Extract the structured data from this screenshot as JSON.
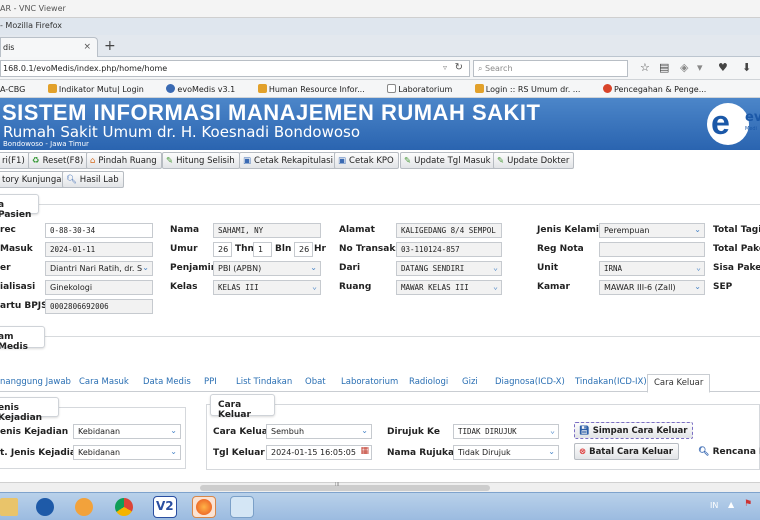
{
  "vnc_title": "AR - VNC Viewer",
  "firefox_title": "- Mozilla Firefox",
  "tab": {
    "label": "dis",
    "close": "×",
    "new": "+"
  },
  "url": "168.0.1/evoMedis/index.php/home/home",
  "search_placeholder": "Search",
  "bookmarks": [
    "A-CBG",
    "Indikator Mutu| Login",
    "evoMedis v3.1",
    "Human Resource Infor...",
    "Laboratorium",
    "Login :: RS Umum dr. ...",
    "Pencegahan & Penge..."
  ],
  "banner": {
    "title": "SISTEM INFORMASI MANAJEMEN RUMAH SAKIT",
    "subtitle": "Rumah Sakit Umum dr. H. Koesnadi Bondowoso",
    "location": "Bondowoso - Jawa Timur",
    "logo_text": "ev",
    "logo_sub": "Medi"
  },
  "toolbar": [
    {
      "label": "ri(F1)",
      "icon": "search-icon"
    },
    {
      "label": "Reset(F8)",
      "icon": "reset-icon"
    },
    {
      "label": "Pindah Ruang",
      "icon": "home-icon"
    },
    {
      "label": "Hitung Selisih",
      "icon": "pencil-icon"
    },
    {
      "label": "Cetak Rekapitulasi",
      "icon": "print-icon"
    },
    {
      "label": "Cetak KPO",
      "icon": "print-icon"
    },
    {
      "label": "Update Tgl Masuk",
      "icon": "pencil-icon"
    },
    {
      "label": "Update Dokter",
      "icon": "pencil-icon"
    }
  ],
  "toolbar2": [
    {
      "label": "tory Kunjungan"
    },
    {
      "label": "Hasil Lab",
      "icon": "search-icon"
    }
  ],
  "section_pasien": "a Pasien",
  "section_medis": "am Medis",
  "fields": {
    "col1": [
      {
        "label": "rec",
        "value": "0-88-30-34"
      },
      {
        "label": "Masuk",
        "value": "2024-01-11"
      },
      {
        "label": "er",
        "value": "Diantri Nari Ratih, dr. S"
      },
      {
        "label": "ialisasi",
        "value": "Ginekologi"
      },
      {
        "label": "artu BPJS",
        "value": "0002806692006"
      }
    ],
    "col2_labels": [
      "Nama",
      "Umur",
      "Penjamin",
      "Kelas"
    ],
    "nama": "SAHAMI, NY",
    "umur": {
      "thn": "26",
      "thn_label": "Thn",
      "bln": "1",
      "bln_label": "Bln",
      "hr": "26",
      "hr_label": "Hr"
    },
    "penjamin": "PBI (APBN)",
    "kelas": "KELAS III",
    "col3_labels": [
      "Alamat",
      "No Transaksi",
      "Dari",
      "Ruang"
    ],
    "alamat": "KALIGEDANG 8/4 SEMPOL I",
    "no_transaksi": "03-110124-857",
    "dari": "DATANG SENDIRI",
    "ruang": "MAWAR KELAS III",
    "col4_labels": [
      "Jenis Kelamin",
      "Reg Nota",
      "Unit",
      "Kamar"
    ],
    "jenis_kelamin": "Perempuan",
    "reg_nota": "",
    "unit": "IRNA",
    "kamar": "MAWAR III-6 (Zall)",
    "col5_labels": [
      "Total Tagiha",
      "Total Paket",
      "Sisa Paket",
      "SEP"
    ]
  },
  "tabs": [
    "nanggung Jawab",
    "Cara Masuk",
    "Data Medis",
    "PPI",
    "List Tindakan",
    "Obat",
    "Laboratorium",
    "Radiologi",
    "Gizi",
    "Diagnosa(ICD-X)",
    "Tindakan(ICD-IX)",
    "Cara Keluar"
  ],
  "jenis_kejadian": {
    "title": "enis Kejadian",
    "label1": "enis Kejadian",
    "value1": "Kebidanan",
    "label2": "t. Jenis Kejadian",
    "value2": "Kebidanan"
  },
  "cara_keluar": {
    "title": "Cara Keluar",
    "cara_keluar_label": "Cara Keluar",
    "cara_keluar_value": "Sembuh",
    "tgl_keluar_label": "Tgl Keluar",
    "tgl_keluar_value": "2024-01-15 16:05:05",
    "dirujuk_label": "Dirujuk Ke",
    "dirujuk_value": "TIDAK DIRUJUK",
    "nama_rujukan_label": "Nama Rujukan",
    "nama_rujukan_value": "Tidak Dirujuk",
    "simpan": "Simpan Cara Keluar",
    "batal": "Batal Cara Keluar",
    "rencana": "Rencana K"
  },
  "scroll_marker": "III",
  "tray": {
    "lang": "IN"
  }
}
